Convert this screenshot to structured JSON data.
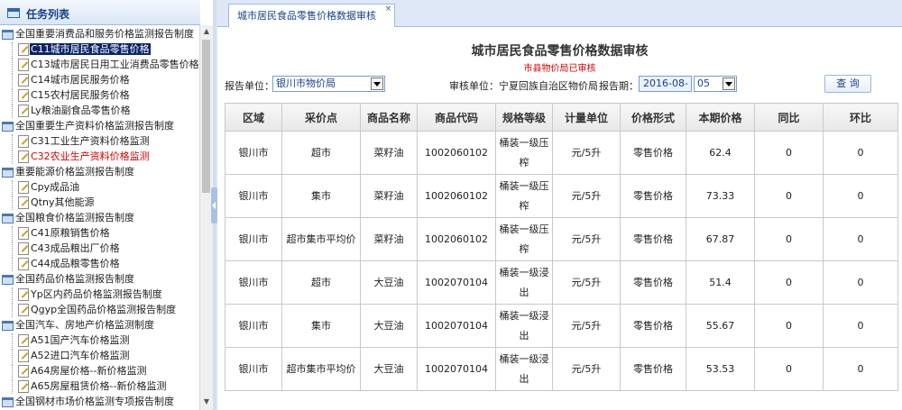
{
  "sidebar": {
    "title": "任务列表",
    "icon": "task-list-icon",
    "tree": [
      {
        "label": "全国重要消费品和服务价格监测报告制度",
        "type": "group"
      },
      {
        "label": "C11城市居民食品零售价格",
        "type": "leaf",
        "selected": true
      },
      {
        "label": "C13城市居民日用工业消费品零售价格",
        "type": "leaf"
      },
      {
        "label": "C14城市居民服务价格",
        "type": "leaf"
      },
      {
        "label": "C15农村居民服务价格",
        "type": "leaf"
      },
      {
        "label": "Ly粮油副食品零售价格",
        "type": "leaf"
      },
      {
        "label": "全国重要生产资料价格监测报告制度",
        "type": "group"
      },
      {
        "label": "C31工业生产资料价格监测",
        "type": "leaf"
      },
      {
        "label": "C32农业生产资料价格监测",
        "type": "leaf",
        "highlight": "red"
      },
      {
        "label": "重要能源价格监测报告制度",
        "type": "group"
      },
      {
        "label": "Cpy成品油",
        "type": "leaf"
      },
      {
        "label": "Qtny其他能源",
        "type": "leaf"
      },
      {
        "label": "全国粮食价格监测报告制度",
        "type": "group"
      },
      {
        "label": "C41原粮销售价格",
        "type": "leaf"
      },
      {
        "label": "C43成品粮出厂价格",
        "type": "leaf"
      },
      {
        "label": "C44成品粮零售价格",
        "type": "leaf"
      },
      {
        "label": "全国药品价格监测报告制度",
        "type": "group"
      },
      {
        "label": "Yp区内药品价格监测报告制度",
        "type": "leaf"
      },
      {
        "label": "Qgyp全国药品价格监测报告制度",
        "type": "leaf"
      },
      {
        "label": "全国汽车、房地产价格监测制度",
        "type": "group"
      },
      {
        "label": "A51国产汽车价格监测",
        "type": "leaf"
      },
      {
        "label": "A52进口汽车价格监测",
        "type": "leaf"
      },
      {
        "label": "A64房屋价格--新价格监测",
        "type": "leaf"
      },
      {
        "label": "A65房屋租赁价格--新价格监测",
        "type": "leaf"
      },
      {
        "label": "全国钢材市场价格监测专项报告制度",
        "type": "group"
      }
    ]
  },
  "tabs": [
    {
      "label": "城市居民食品零售价格数据审核",
      "close": "×"
    }
  ],
  "page": {
    "title": "城市居民食品零售价格数据审核",
    "subtitle": "市县物价局已审核"
  },
  "filters": {
    "report_unit_label": "报告单位：",
    "report_unit_value": "银川市物价局",
    "audit_unit_label": "审核单位：宁夏回族自治区物价局",
    "period_label": "报告期：",
    "period_value": "2016-08-",
    "day_value": "05",
    "query_label": "查 询"
  },
  "table": {
    "columns": [
      "区域",
      "采价点",
      "商品名称",
      "商品代码",
      "规格等级",
      "计量单位",
      "价格形式",
      "本期价格",
      "同比",
      "环比"
    ],
    "rows": [
      [
        "银川市",
        "超市",
        "菜籽油",
        "1002060102",
        "桶装一级压榨",
        "元/5升",
        "零售价格",
        "62.4",
        "0",
        "0"
      ],
      [
        "银川市",
        "集市",
        "菜籽油",
        "1002060102",
        "桶装一级压榨",
        "元/5升",
        "零售价格",
        "73.33",
        "0",
        "0"
      ],
      [
        "银川市",
        "超市集市平均价",
        "菜籽油",
        "1002060102",
        "桶装一级压榨",
        "元/5升",
        "零售价格",
        "67.87",
        "0",
        "0"
      ],
      [
        "银川市",
        "超市",
        "大豆油",
        "1002070104",
        "桶装一级浸出",
        "元/5升",
        "零售价格",
        "51.4",
        "0",
        "0"
      ],
      [
        "银川市",
        "集市",
        "大豆油",
        "1002070104",
        "桶装一级浸出",
        "元/5升",
        "零售价格",
        "55.67",
        "0",
        "0"
      ],
      [
        "银川市",
        "超市集市平均价",
        "大豆油",
        "1002070104",
        "桶装一级浸出",
        "元/5升",
        "零售价格",
        "53.53",
        "0",
        "0"
      ]
    ]
  },
  "colors": {
    "header_text": "#15428b",
    "panel_border": "#99bbe8",
    "selected_bg": "#0a246a",
    "red_text": "#d80000"
  }
}
